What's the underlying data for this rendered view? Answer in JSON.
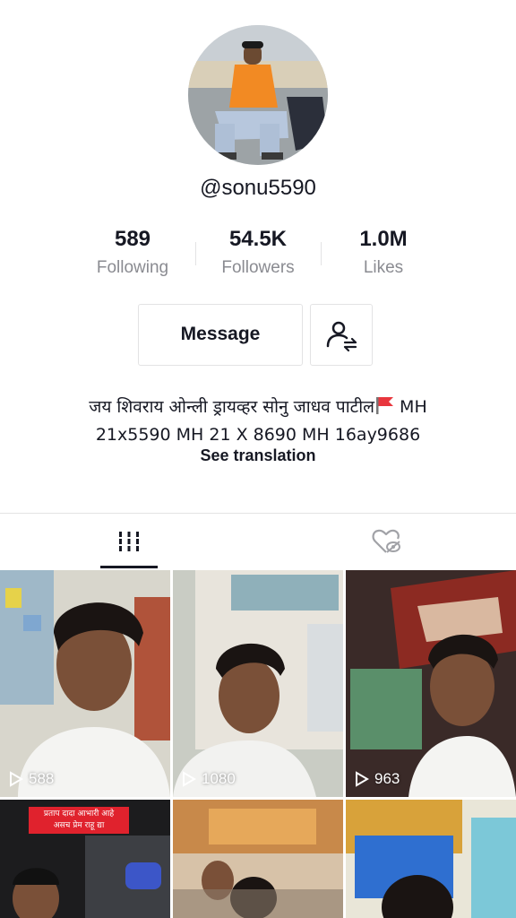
{
  "profile": {
    "username": "@sonu5590",
    "stats": [
      {
        "value": "589",
        "label": "Following"
      },
      {
        "value": "54.5K",
        "label": "Followers"
      },
      {
        "value": "1.0M",
        "label": "Likes"
      }
    ],
    "message_label": "Message",
    "bio_line1": "जय शिवराय ओन्ली ड्रायव्हर सोनु जाधव पाटील",
    "bio_line1_suffix": " MH",
    "bio_line2": "21x5590 MH 21 X 8690 MH 16ay9686",
    "see_translation": "See translation"
  },
  "tabs": [
    {
      "icon": "grid-icon",
      "active": true
    },
    {
      "icon": "liked-hidden-icon",
      "active": false
    }
  ],
  "videos": [
    {
      "views": "588"
    },
    {
      "views": "1080"
    },
    {
      "views": "963"
    },
    {
      "banner_line1": "प्रताप दादा आभारी आहे",
      "banner_line2": "असच प्रेम राहू द्या"
    },
    {},
    {}
  ],
  "colors": {
    "text": "#161823",
    "muted": "#8a8b91",
    "border": "#e3e3e4",
    "flag": "#e8363d"
  }
}
